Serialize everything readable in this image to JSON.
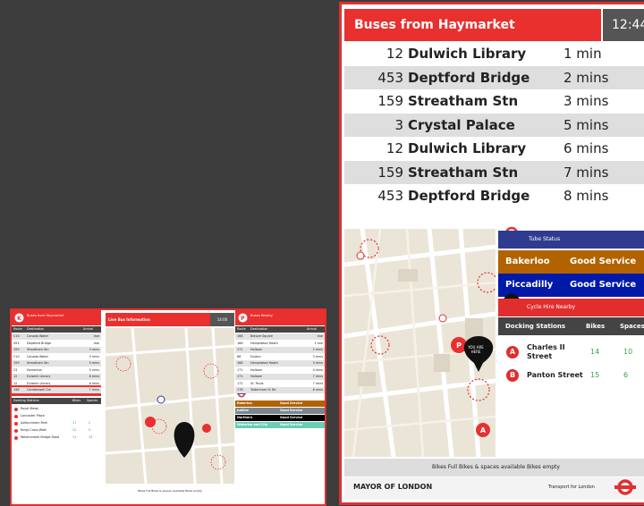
{
  "big_display": {
    "header_title": "Buses from Haymarket",
    "clock": "12:44",
    "arrivals": [
      {
        "route": "12",
        "destination": "Dulwich Library",
        "time": "1 min"
      },
      {
        "route": "453",
        "destination": "Deptford Bridge",
        "time": "2 mins"
      },
      {
        "route": "159",
        "destination": "Streatham Stn",
        "time": "3 mins"
      },
      {
        "route": "3",
        "destination": "Crystal Palace",
        "time": "5 mins"
      },
      {
        "route": "12",
        "destination": "Dulwich Library",
        "time": "6 mins"
      },
      {
        "route": "159",
        "destination": "Streatham Stn",
        "time": "7 mins"
      },
      {
        "route": "453",
        "destination": "Deptford Bridge",
        "time": "8 mins"
      }
    ],
    "tube_status": {
      "title": "Tube Status",
      "lines": [
        {
          "name": "Bakerloo",
          "status": "Good Service",
          "color": "#b26300"
        },
        {
          "name": "Piccadilly",
          "status": "Good Service",
          "color": "#0019a8"
        }
      ]
    },
    "cycle_hire": {
      "title": "Cycle Hire Nearby",
      "headers": [
        "Docking Stations",
        "Bikes",
        "Spaces"
      ],
      "stations": [
        {
          "letter": "A",
          "name": "Charles II Street",
          "bikes": "14",
          "spaces": "10"
        },
        {
          "letter": "B",
          "name": "Panton Street",
          "bikes": "15",
          "spaces": "6"
        }
      ]
    },
    "legend": "Bikes Full   Bikes & spaces available   Bikes empty",
    "footer_left": "MAYOR OF LONDON",
    "footer_right": "Transport for London",
    "map_marker": "YOU ARE HERE"
  },
  "small_display": {
    "left_title": "Buses from Haymarket",
    "left_headers": [
      "Route",
      "Destination",
      "Arrival"
    ],
    "left_rows": [
      {
        "route": "C10",
        "dest": "Canada Water",
        "time": "due"
      },
      {
        "route": "453",
        "dest": "Deptford Bridge",
        "time": "due"
      },
      {
        "route": "159",
        "dest": "Streatham Stn",
        "time": "3 mins"
      },
      {
        "route": "C10",
        "dest": "Canada Water",
        "time": "3 mins"
      },
      {
        "route": "159",
        "dest": "Streatham Stn",
        "time": "5 mins"
      },
      {
        "route": "23",
        "dest": "Homerton",
        "time": "5 mins"
      },
      {
        "route": "12",
        "dest": "Dulwich Library",
        "time": "6 mins"
      },
      {
        "route": "12",
        "dest": "Dulwich Library",
        "time": "6 mins"
      },
      {
        "route": "148",
        "dest": "Camberwell Grn",
        "time": "7 mins"
      }
    ],
    "cycle_title": "Cycle Hire Nearby",
    "cycle_headers": [
      "Docking Stations",
      "Bikes",
      "Spaces"
    ],
    "cycle_rows": [
      {
        "name": "Royal Mews",
        "bikes": "",
        "spaces": ""
      },
      {
        "name": "Lancaster Place",
        "bikes": "",
        "spaces": ""
      },
      {
        "name": "Ashburnham Park",
        "bikes": "17",
        "spaces": "2"
      },
      {
        "name": "Kings Cross Walk",
        "bikes": "22",
        "spaces": "9"
      },
      {
        "name": "Westminster Bridge Road",
        "bikes": "11",
        "spaces": "13"
      }
    ],
    "center_title": "Live Bus Information",
    "center_clock": "14:06",
    "center_legend": "Bikes Full   Bikes & spaces available   Bikes empty",
    "right_title": "Buses Nearby",
    "right_headers": [
      "Route",
      "Destination",
      "Arrival"
    ],
    "right_rows": [
      {
        "route": "168",
        "dest": "Belsize Square",
        "time": "due"
      },
      {
        "route": "168",
        "dest": "Hampstead Heath",
        "time": "1 min"
      },
      {
        "route": "171",
        "dest": "Holborn",
        "time": "2 mins"
      },
      {
        "route": "68",
        "dest": "Euston",
        "time": "3 mins"
      },
      {
        "route": "168",
        "dest": "Hampstead Heath",
        "time": "3 mins"
      },
      {
        "route": "171",
        "dest": "Holborn",
        "time": "4 mins"
      },
      {
        "route": "171",
        "dest": "Holborn",
        "time": "7 mins"
      },
      {
        "route": "172",
        "dest": "St. Pauls",
        "time": "7 mins"
      },
      {
        "route": "176",
        "dest": "Tottenham Ct Rd",
        "time": "8 mins"
      }
    ],
    "tube_title": "Tube Status",
    "tube_lines": [
      {
        "name": "Bakerloo",
        "status": "Good Service",
        "color": "#b26300"
      },
      {
        "name": "Jubilee",
        "status": "Good Service",
        "color": "#7b868c"
      },
      {
        "name": "Northern",
        "status": "Good Service",
        "color": "#000000"
      },
      {
        "name": "Waterloo and City",
        "status": "Good Service",
        "color": "#6bcdb2"
      }
    ]
  }
}
